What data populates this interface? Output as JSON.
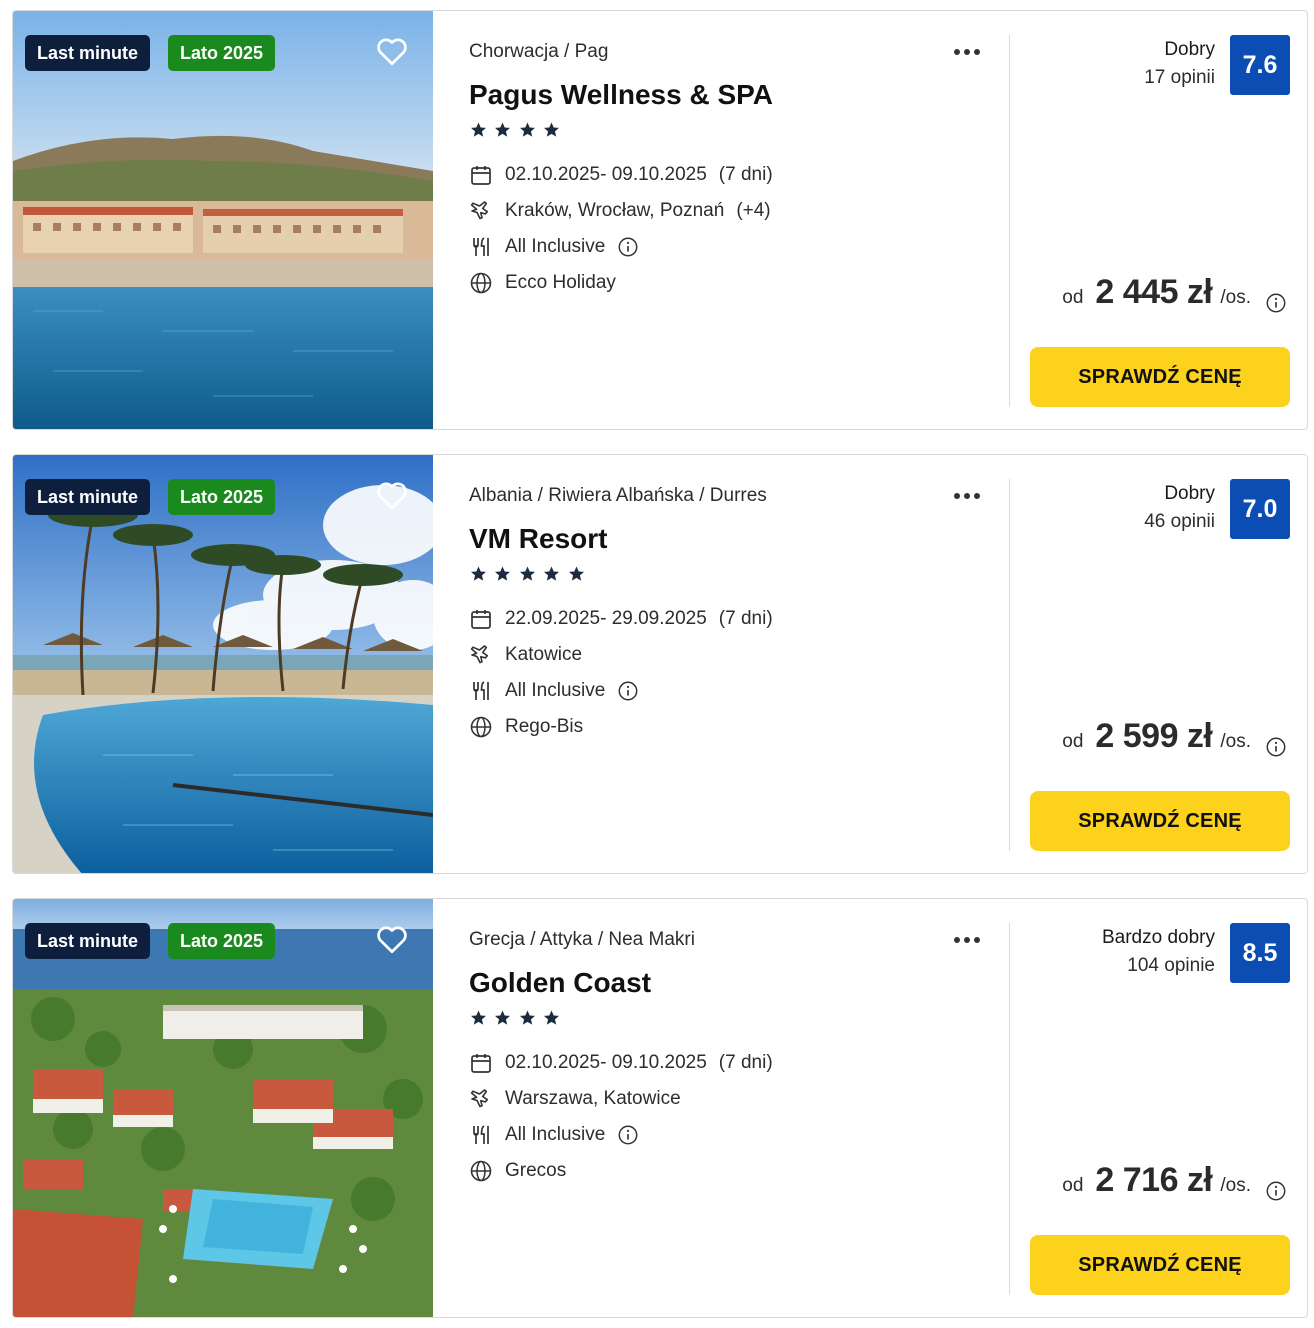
{
  "colors": {
    "badge_last_minute": "#0e1f3d",
    "badge_season": "#1a8a1f",
    "score_bg": "#0b4db3",
    "cta_bg": "#fcd21d"
  },
  "icons": {
    "favorite": "heart-outline-icon",
    "more": "three-dots-icon",
    "dates": "calendar-icon",
    "departure": "plane-icon",
    "board": "cutlery-icon",
    "operator": "globe-icon",
    "info": "info-circle-icon"
  },
  "offers": [
    {
      "badge_last_minute": "Last minute",
      "badge_season": "Lato 2025",
      "location": "Chorwacja / Pag",
      "name": "Pagus Wellness & SPA",
      "stars": 4,
      "dates": "02.10.2025- 09.10.2025",
      "duration": "(7 dni)",
      "departure": "Kraków, Wrocław, Poznań",
      "departure_extra": "(+4)",
      "board": "All Inclusive",
      "operator": "Ecco Holiday",
      "rating_label": "Dobry",
      "rating_count": "17 opinii",
      "score": "7.6",
      "price_from": "od",
      "price": "2 445 zł",
      "price_per": "/os.",
      "cta": "SPRAWDŹ CENĘ",
      "photo": "sea-resort"
    },
    {
      "badge_last_minute": "Last minute",
      "badge_season": "Lato 2025",
      "location": "Albania / Riwiera Albańska / Durres",
      "name": "VM Resort",
      "stars": 5,
      "dates": "22.09.2025- 29.09.2025",
      "duration": "(7 dni)",
      "departure": "Katowice",
      "departure_extra": "",
      "board": "All Inclusive",
      "operator": "Rego-Bis",
      "rating_label": "Dobry",
      "rating_count": "46 opinii",
      "score": "7.0",
      "price_from": "od",
      "price": "2 599 zł",
      "price_per": "/os.",
      "cta": "SPRAWDŹ CENĘ",
      "photo": "pool-palms"
    },
    {
      "badge_last_minute": "Last minute",
      "badge_season": "Lato 2025",
      "location": "Grecja / Attyka / Nea Makri",
      "name": "Golden Coast",
      "stars": 4,
      "dates": "02.10.2025- 09.10.2025",
      "duration": "(7 dni)",
      "departure": "Warszawa, Katowice",
      "departure_extra": "",
      "board": "All Inclusive",
      "operator": "Grecos",
      "rating_label": "Bardzo dobry",
      "rating_count": "104 opinie",
      "score": "8.5",
      "price_from": "od",
      "price": "2 716 zł",
      "price_per": "/os.",
      "cta": "SPRAWDŹ CENĘ",
      "photo": "aerial-resort"
    }
  ]
}
